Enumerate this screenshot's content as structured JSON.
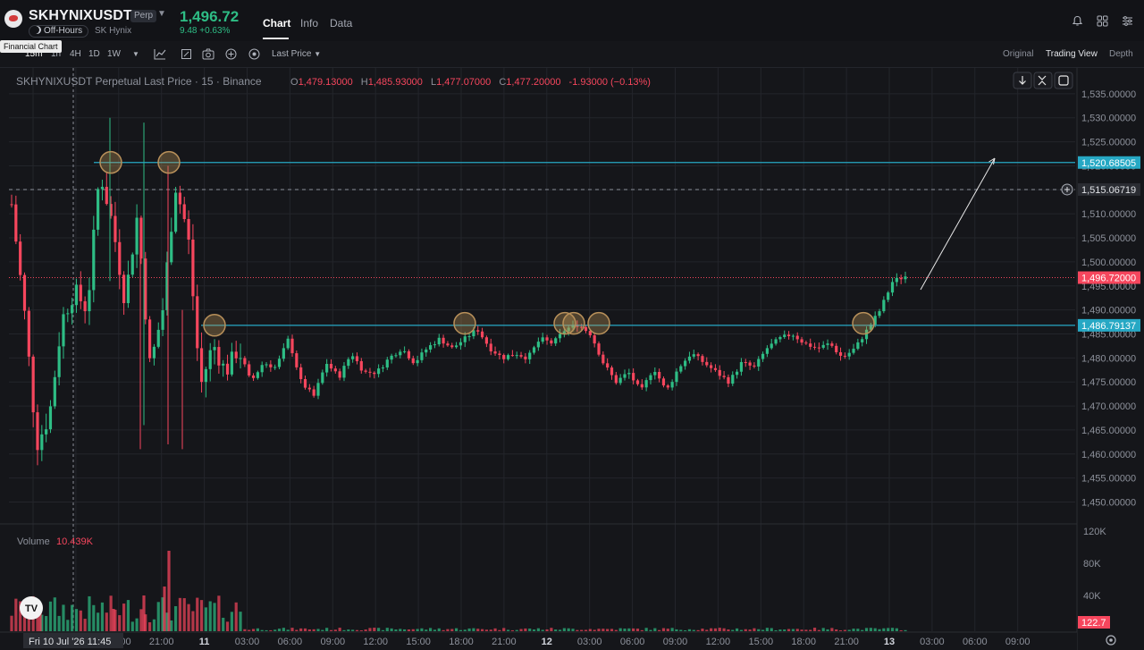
{
  "header": {
    "symbol": "SKHYNIXUSDT",
    "badge": "Perp",
    "status": "Off-Hours",
    "company": "SK Hynix",
    "last_price": "1,496.72",
    "change": "9.48 +0.63%",
    "tabs": [
      "Chart",
      "Info",
      "Data"
    ],
    "active_tab": "Chart"
  },
  "toolbar": {
    "tooltip": "Financial Chart",
    "intervals": [
      "15m",
      "1h",
      "4H",
      "1D",
      "1W"
    ],
    "active_interval": "15m",
    "price_type": "Last Price",
    "view_tabs": [
      "Original",
      "Trading View",
      "Depth"
    ],
    "active_view": "Trading View"
  },
  "colors": {
    "up": "#2ebd85",
    "down": "#f6465d",
    "level_line": "#26a8c4",
    "background": "#15161a"
  },
  "chart_data": {
    "type": "candlestick",
    "title": "SKHYNIXUSDT Perpetual Last Price · 15 · Binance",
    "legend": {
      "open": "1,479.13000",
      "high": "1,485.93000",
      "low": "1,477.07000",
      "close": "1,477.20000",
      "change": "-1.93000 (−0.13%)"
    },
    "y_range": [
      1446,
      1540
    ],
    "y_ticks": [
      "1,535.00000",
      "1,530.00000",
      "1,525.00000",
      "1,520.00000",
      "1,515.00000",
      "1,510.00000",
      "1,505.00000",
      "1,500.00000",
      "1,495.00000",
      "1,490.00000",
      "1,485.00000",
      "1,480.00000",
      "1,475.00000",
      "1,470.00000",
      "1,465.00000",
      "1,460.00000",
      "1,455.00000",
      "1,450.00000"
    ],
    "x_labels": [
      "Fri 10 Jul '26  11:45",
      "00",
      "18:00",
      "21:00",
      "11",
      "03:00",
      "06:00",
      "09:00",
      "12:00",
      "15:00",
      "18:00",
      "21:00",
      "12",
      "03:00",
      "06:00",
      "09:00",
      "12:00",
      "15:00",
      "18:00",
      "21:00",
      "13",
      "03:00",
      "06:00",
      "09:00"
    ],
    "horizontal_levels": [
      {
        "price": 1520.68505,
        "label": "1,520.68505"
      },
      {
        "price": 1486.79137,
        "label": "1,486.79137"
      }
    ],
    "crosshair": {
      "price": 1515.06719,
      "label": "1,515.06719"
    },
    "last_price_label": "1,496.72000",
    "last_price": 1496.72,
    "touch_points_count": 8,
    "annotation": "arrow pointing up toward 1,520.68505",
    "path": [
      1512,
      1490,
      1462,
      1468,
      1488,
      1494,
      1490,
      1519,
      1508,
      1492,
      1510,
      1478,
      1490,
      1516,
      1506,
      1474,
      1483,
      1477,
      1482,
      1475,
      1479,
      1478,
      1484,
      1475,
      1472,
      1479,
      1476,
      1481,
      1477,
      1477,
      1480,
      1482,
      1479,
      1482,
      1484,
      1482,
      1484,
      1486,
      1482,
      1480,
      1481,
      1480,
      1484,
      1483,
      1486,
      1487,
      1485,
      1479,
      1475,
      1477,
      1473,
      1478,
      1473,
      1478,
      1481,
      1479,
      1477,
      1475,
      1479,
      1478,
      1482,
      1484,
      1485,
      1483,
      1482,
      1483,
      1480,
      1482,
      1486,
      1490,
      1496,
      1497
    ],
    "volume": {
      "label": "Volume",
      "value": "10.439K",
      "value_tag": "122.7",
      "y_ticks": [
        "120K",
        "80K",
        "40K"
      ]
    }
  }
}
